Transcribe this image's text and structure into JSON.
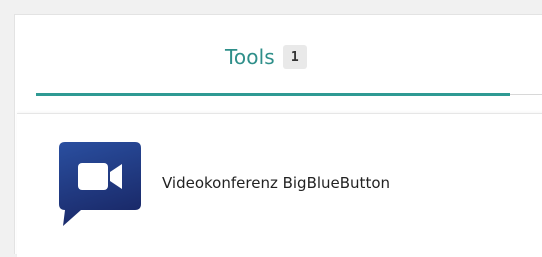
{
  "tabs": {
    "active": {
      "label": "Tools",
      "count": "1"
    }
  },
  "tools": [
    {
      "label": "Videokonferenz BigBlueButton",
      "icon": "video-camera-chat-icon"
    }
  ],
  "colors": {
    "accent": "#2f9a93",
    "tab_text": "#2f8f8a",
    "icon_bg_top": "#2a4fa0",
    "icon_bg_bottom": "#1a2a6a"
  }
}
